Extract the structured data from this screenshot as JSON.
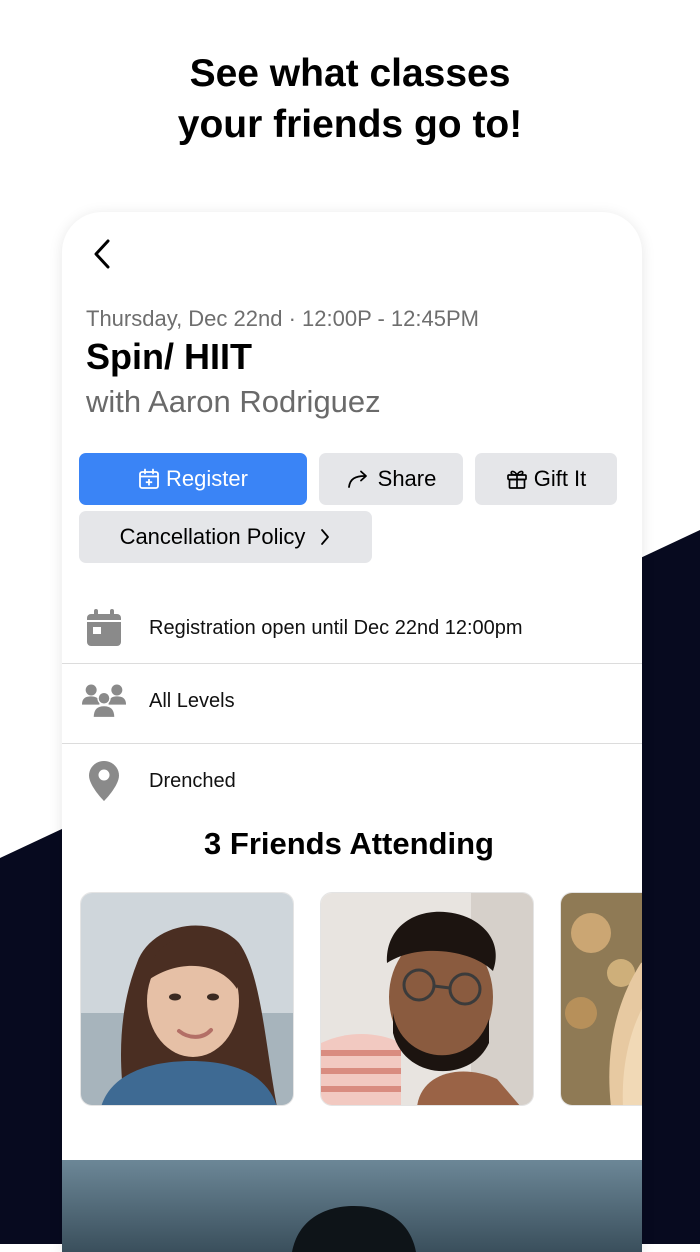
{
  "headline": {
    "line1": "See what classes",
    "line2": "your friends go to!"
  },
  "colors": {
    "dark_navy": "#070a1f",
    "primary_button": "#3a84f6",
    "secondary_button": "#e5e6e9",
    "icon_gray": "#8a8a8a"
  },
  "class_detail": {
    "back_icon": "chevron-left-icon",
    "date_time": "Thursday, Dec 22nd · 12:00P - 12:45PM",
    "title": "Spin/ HIIT",
    "instructor": "with Aaron Rodriguez",
    "buttons": {
      "register": {
        "label": "Register",
        "icon": "calendar-plus-icon"
      },
      "share": {
        "label": "Share",
        "icon": "share-arrow-icon"
      },
      "gift": {
        "label": "Gift It",
        "icon": "gift-icon"
      },
      "cancellation": {
        "label": "Cancellation Policy",
        "icon": "chevron-right-icon"
      }
    },
    "info_rows": [
      {
        "icon": "calendar-icon",
        "text": "Registration open until Dec 22nd 12:00pm"
      },
      {
        "icon": "group-icon",
        "text": "All Levels"
      },
      {
        "icon": "location-pin-icon",
        "text": "Drenched"
      }
    ],
    "friends": {
      "heading": "3 Friends Attending",
      "photos": [
        "friend-photo-woman",
        "friend-photo-man-glasses",
        "friend-photo-blonde"
      ]
    }
  }
}
